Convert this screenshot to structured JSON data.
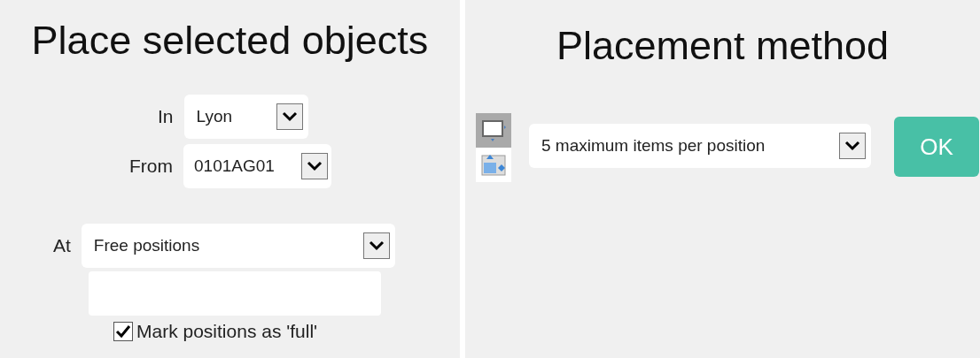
{
  "left_panel": {
    "title": "Place selected objects",
    "in": {
      "label": "In",
      "value": "Lyon"
    },
    "from": {
      "label": "From",
      "value": "0101AG01"
    },
    "at": {
      "label": "At",
      "value": "Free positions"
    },
    "mark_full": {
      "label": "Mark positions as 'full'",
      "checked": true
    }
  },
  "right_panel": {
    "title": "Placement method",
    "modes": [
      {
        "kind": "screen",
        "selected": true
      },
      {
        "kind": "move",
        "selected": false
      }
    ],
    "method": {
      "value": "5 maximum items per position"
    },
    "ok_button": "OK"
  }
}
